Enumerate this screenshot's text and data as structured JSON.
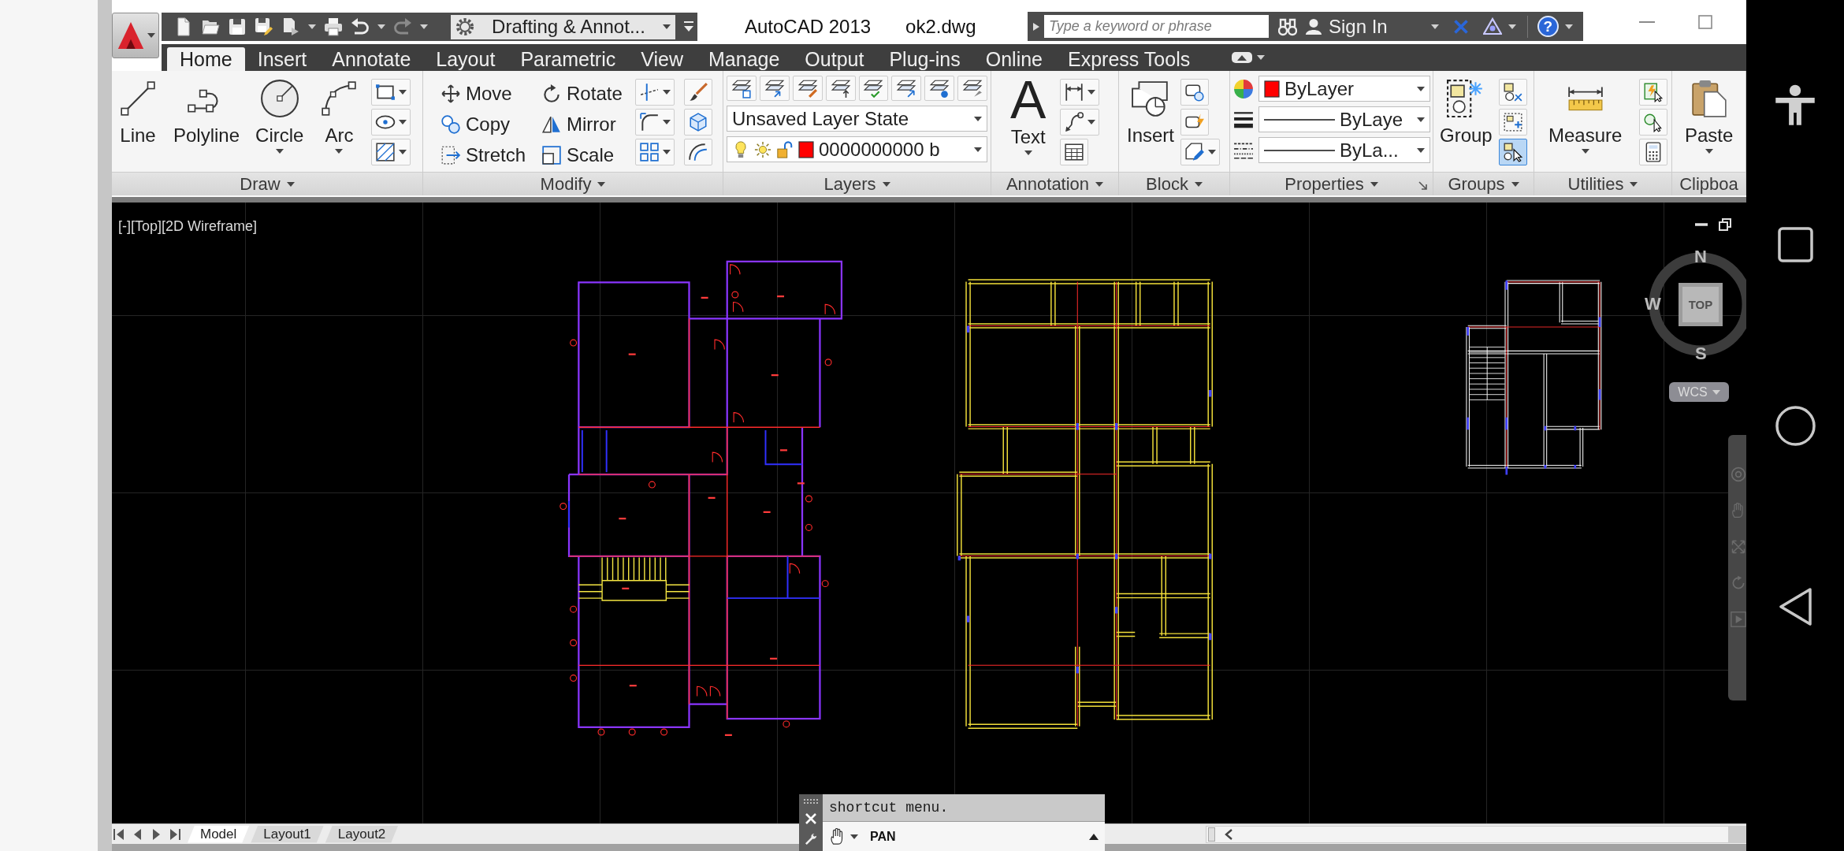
{
  "title_bar": {
    "workspace": "Drafting & Annot...",
    "app_name": "AutoCAD 2013",
    "file_name": "ok2.dwg"
  },
  "info_center": {
    "search": {
      "placeholder": "Type a keyword or phrase"
    },
    "sign_in": "Sign In",
    "help": "?"
  },
  "ribbon_tabs": [
    {
      "label": "Home",
      "selected": true
    },
    {
      "label": "Insert",
      "selected": false
    },
    {
      "label": "Annotate",
      "selected": false
    },
    {
      "label": "Layout",
      "selected": false
    },
    {
      "label": "Parametric",
      "selected": false
    },
    {
      "label": "View",
      "selected": false
    },
    {
      "label": "Manage",
      "selected": false
    },
    {
      "label": "Output",
      "selected": false
    },
    {
      "label": "Plug-ins",
      "selected": false
    },
    {
      "label": "Online",
      "selected": false
    },
    {
      "label": "Express Tools",
      "selected": false
    }
  ],
  "ribbon_panels": [
    {
      "kind": "draw",
      "title": "Draw",
      "menu": true,
      "large_buttons": [
        {
          "label": "Line",
          "dropdown": false
        },
        {
          "label": "Polyline",
          "dropdown": false
        },
        {
          "label": "Circle",
          "dropdown": true
        },
        {
          "label": "Arc",
          "dropdown": true
        }
      ]
    },
    {
      "kind": "modify",
      "title": "Modify",
      "menu": true,
      "tools": [
        "Move",
        "Copy",
        "Stretch",
        "Rotate",
        "Mirror",
        "Scale"
      ]
    },
    {
      "kind": "layers",
      "title": "Layers",
      "menu": true,
      "layer_state": "Unsaved Layer State",
      "current_layer": "0000000000 b"
    },
    {
      "kind": "annotation",
      "title": "Annotation",
      "menu": true,
      "large_buttons": [
        {
          "label": "Text",
          "glyph": "A",
          "dropdown": true
        }
      ]
    },
    {
      "kind": "block",
      "title": "Block",
      "menu": true,
      "large_buttons": [
        {
          "label": "Insert",
          "dropdown": false
        }
      ]
    },
    {
      "kind": "properties",
      "title": "Properties",
      "menu": true,
      "launcher": true,
      "object_color": "ByLayer",
      "lineweight": "ByLaye",
      "linetype": "ByLa..."
    },
    {
      "kind": "groups",
      "title": "Groups",
      "menu": true,
      "large_buttons": [
        {
          "label": "Group",
          "dropdown": false
        }
      ],
      "group_selection": {
        "on": true
      }
    },
    {
      "kind": "utilities",
      "title": "Utilities",
      "menu": true,
      "large_buttons": [
        {
          "label": "Measure",
          "dropdown": true
        }
      ]
    },
    {
      "kind": "clipboard",
      "title": "Clipboa",
      "menu": false,
      "large_buttons": [
        {
          "label": "Paste",
          "dropdown": true
        }
      ]
    }
  ],
  "viewport": {
    "controls": [
      "[-]",
      "[Top]",
      "[2D Wireframe]"
    ],
    "viewcube": {
      "north": "N",
      "west": "W",
      "face": "TOP",
      "south": "S"
    },
    "ucs_menu": "WCS"
  },
  "layout_tabs": [
    {
      "label": "Model",
      "selected": true
    },
    {
      "label": "Layout1",
      "selected": false
    },
    {
      "label": "Layout2",
      "selected": false
    }
  ],
  "command_line": {
    "history": "shortcut menu.",
    "command": "PAN"
  }
}
